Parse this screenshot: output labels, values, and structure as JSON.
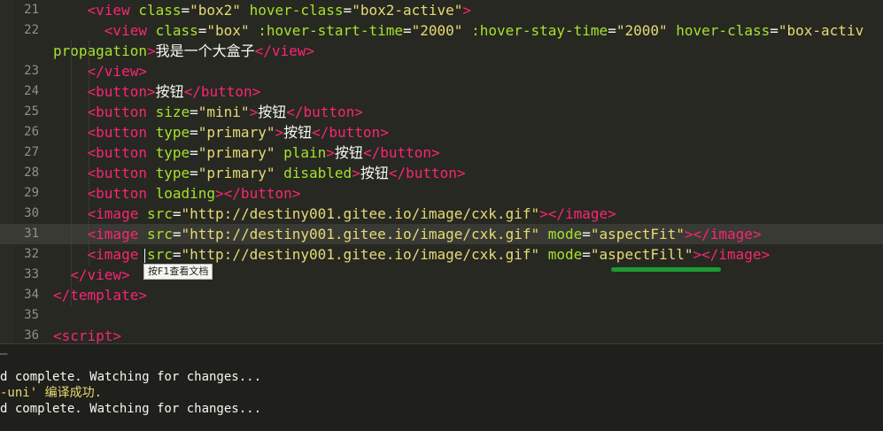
{
  "editor": {
    "active_line": "31",
    "lines": [
      {
        "num": "21",
        "indent": "    ",
        "segs": [
          [
            "tg",
            "<view "
          ],
          [
            "at",
            "class"
          ],
          [
            "tx",
            "="
          ],
          [
            "st",
            "\"box2\""
          ],
          [
            "tx",
            " "
          ],
          [
            "at",
            "hover-class"
          ],
          [
            "tx",
            "="
          ],
          [
            "st",
            "\"box2-active\""
          ],
          [
            "tg",
            ">"
          ]
        ]
      },
      {
        "num": "22",
        "indent": "      ",
        "segs": [
          [
            "tg",
            "<view "
          ],
          [
            "at",
            "class"
          ],
          [
            "tx",
            "="
          ],
          [
            "st",
            "\"box\""
          ],
          [
            "tx",
            " "
          ],
          [
            "at",
            ":hover-start-time"
          ],
          [
            "tx",
            "="
          ],
          [
            "st",
            "\"2000\""
          ],
          [
            "tx",
            " "
          ],
          [
            "at",
            ":hover-stay-time"
          ],
          [
            "tx",
            "="
          ],
          [
            "st",
            "\"2000\""
          ],
          [
            "tx",
            " "
          ],
          [
            "at",
            "hover-class"
          ],
          [
            "tx",
            "="
          ],
          [
            "st",
            "\"box-activ"
          ]
        ]
      },
      {
        "num": "",
        "indent": "",
        "segs": [
          [
            "at",
            "propagation"
          ],
          [
            "tg",
            ">"
          ],
          [
            "tx",
            "我是一个大盒子"
          ],
          [
            "tg",
            "</view>"
          ]
        ]
      },
      {
        "num": "23",
        "indent": "    ",
        "segs": [
          [
            "tg",
            "</view>"
          ]
        ]
      },
      {
        "num": "24",
        "indent": "    ",
        "segs": [
          [
            "tg",
            "<button>"
          ],
          [
            "tx",
            "按钮"
          ],
          [
            "tg",
            "</button>"
          ]
        ]
      },
      {
        "num": "25",
        "indent": "    ",
        "segs": [
          [
            "tg",
            "<button "
          ],
          [
            "at",
            "size"
          ],
          [
            "tx",
            "="
          ],
          [
            "st",
            "\"mini\""
          ],
          [
            "tg",
            ">"
          ],
          [
            "tx",
            "按钮"
          ],
          [
            "tg",
            "</button>"
          ]
        ]
      },
      {
        "num": "26",
        "indent": "    ",
        "segs": [
          [
            "tg",
            "<button "
          ],
          [
            "at",
            "type"
          ],
          [
            "tx",
            "="
          ],
          [
            "st",
            "\"primary\""
          ],
          [
            "tg",
            ">"
          ],
          [
            "tx",
            "按钮"
          ],
          [
            "tg",
            "</button>"
          ]
        ]
      },
      {
        "num": "27",
        "indent": "    ",
        "segs": [
          [
            "tg",
            "<button "
          ],
          [
            "at",
            "type"
          ],
          [
            "tx",
            "="
          ],
          [
            "st",
            "\"primary\""
          ],
          [
            "tx",
            " "
          ],
          [
            "at",
            "plain"
          ],
          [
            "tg",
            ">"
          ],
          [
            "tx",
            "按钮"
          ],
          [
            "tg",
            "</button>"
          ]
        ]
      },
      {
        "num": "28",
        "indent": "    ",
        "segs": [
          [
            "tg",
            "<button "
          ],
          [
            "at",
            "type"
          ],
          [
            "tx",
            "="
          ],
          [
            "st",
            "\"primary\""
          ],
          [
            "tx",
            " "
          ],
          [
            "at",
            "disabled"
          ],
          [
            "tg",
            ">"
          ],
          [
            "tx",
            "按钮"
          ],
          [
            "tg",
            "</button>"
          ]
        ]
      },
      {
        "num": "29",
        "indent": "    ",
        "segs": [
          [
            "tg",
            "<button "
          ],
          [
            "at",
            "loading"
          ],
          [
            "tg",
            "></button>"
          ]
        ]
      },
      {
        "num": "30",
        "indent": "    ",
        "segs": [
          [
            "tg",
            "<image "
          ],
          [
            "at",
            "src"
          ],
          [
            "tx",
            "="
          ],
          [
            "st",
            "\"http://destiny001.gitee.io/image/cxk.gif\""
          ],
          [
            "tg",
            "></image>"
          ]
        ]
      },
      {
        "num": "31",
        "indent": "    ",
        "segs": [
          [
            "tg",
            "<image "
          ],
          [
            "at",
            "src"
          ],
          [
            "tx",
            "="
          ],
          [
            "st",
            "\"http://destiny001.gitee.io/image/cxk.gif\""
          ],
          [
            "tx",
            " "
          ],
          [
            "at",
            "mode"
          ],
          [
            "tx",
            "="
          ],
          [
            "st",
            "\"aspectFit\""
          ],
          [
            "tg",
            "></image>"
          ]
        ]
      },
      {
        "num": "32",
        "indent": "    ",
        "segs": [
          [
            "tg",
            "<image "
          ],
          [
            "at",
            "src"
          ],
          [
            "tx",
            "="
          ],
          [
            "st",
            "\"http://destiny001.gitee.io/image/cxk.gif\""
          ],
          [
            "tx",
            " "
          ],
          [
            "at",
            "mode"
          ],
          [
            "tx",
            "="
          ],
          [
            "st",
            "\"aspectFill\""
          ],
          [
            "tg",
            "></image>"
          ]
        ]
      },
      {
        "num": "33",
        "indent": "  ",
        "segs": [
          [
            "tg",
            "</view>"
          ]
        ]
      },
      {
        "num": "34",
        "indent": "",
        "segs": [
          [
            "tg",
            "</template>"
          ]
        ]
      },
      {
        "num": "35",
        "indent": "",
        "segs": []
      },
      {
        "num": "36",
        "indent": "",
        "segs": [
          [
            "tg",
            "<script>"
          ]
        ]
      }
    ],
    "tooltip": "按F1查看文档"
  },
  "terminal": {
    "lines": [
      {
        "cls": "tsep",
        "text": "—"
      },
      {
        "cls": "",
        "text": "d complete. Watching for changes..."
      },
      {
        "cls": "tstatus",
        "text": "-uni' 编译成功."
      },
      {
        "cls": "",
        "text": "d complete. Watching for changes..."
      }
    ]
  },
  "colors": {
    "background": "#272822",
    "tag": "#f92672",
    "attr": "#a6e22e",
    "string": "#e6db74",
    "text": "#f8f8f2",
    "squiggle": "#1e9a34"
  }
}
